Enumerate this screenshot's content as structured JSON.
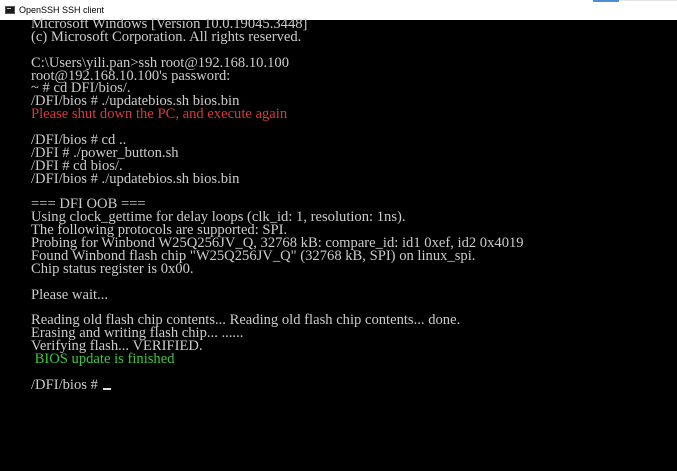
{
  "window": {
    "title": "OpenSSH SSH client",
    "icon": "console-app-icon"
  },
  "colors": {
    "background": "#000000",
    "text": "#cccccc",
    "error": "#d63a3a",
    "success": "#3cc83c"
  },
  "console": {
    "line_01": "Microsoft Windows [Version 10.0.19045.3448]",
    "line_02": "(c) Microsoft Corporation. All rights reserved.",
    "line_03": "C:\\Users\\yili.pan>ssh root@192.168.10.100",
    "line_04": "root@192.168.10.100's password:",
    "line_05": "~ # cd DFI/bios/.",
    "line_06": "/DFI/bios # ./updatebios.sh bios.bin",
    "line_07": "Please shut down the PC, and execute again",
    "line_08": "/DFI/bios # cd ..",
    "line_09": "/DFI # ./power_button.sh",
    "line_10": "/DFI # cd bios/.",
    "line_11": "/DFI/bios # ./updatebios.sh bios.bin",
    "line_12": "=== DFI OOB ===",
    "line_13": "Using clock_gettime for delay loops (clk_id: 1, resolution: 1ns).",
    "line_14": "The following protocols are supported: SPI.",
    "line_15": "Probing for Winbond W25Q256JV_Q, 32768 kB: compare_id: id1 0xef, id2 0x4019",
    "line_16": "Found Winbond flash chip \"W25Q256JV_Q\" (32768 kB, SPI) on linux_spi.",
    "line_17": "Chip status register is 0x00.",
    "line_18": "Please wait...",
    "line_19": "Reading old flash chip contents... Reading old flash chip contents... done.",
    "line_20": "Erasing and writing flash chip... ......",
    "line_21": "Verifying flash... VERIFIED.",
    "line_22": " BIOS update is finished",
    "line_23": "/DFI/bios # "
  }
}
